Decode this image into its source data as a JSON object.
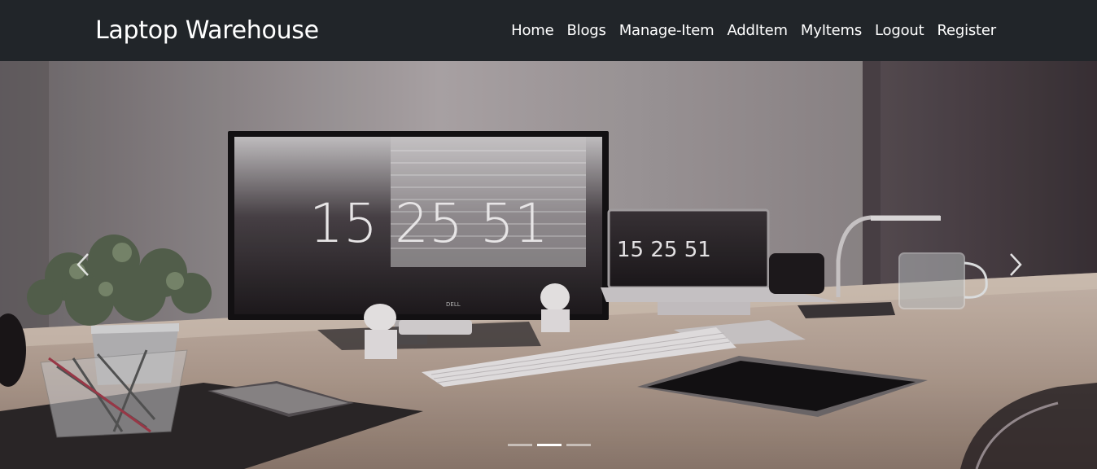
{
  "brand": "Laptop Warehouse",
  "nav": {
    "home": "Home",
    "blogs": "Blogs",
    "manage_item": "Manage-Item",
    "add_item": "AddItem",
    "my_items": "MyItems",
    "logout": "Logout",
    "register": "Register"
  },
  "hero": {
    "monitor_clock": "15 25 51",
    "laptop_clock": "15 25 51",
    "monitor_brand": "DELL"
  },
  "carousel": {
    "slide_count": 3,
    "active_index": 1
  },
  "colors": {
    "navbar_bg": "#212529",
    "nav_text": "#ffffff"
  }
}
